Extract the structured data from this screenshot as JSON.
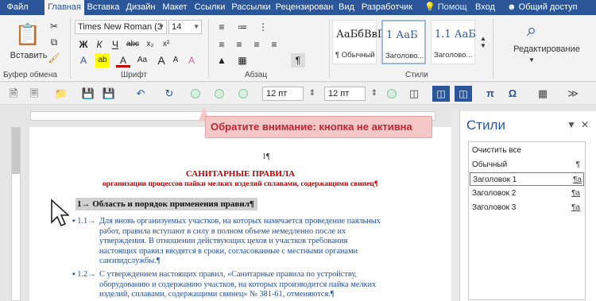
{
  "tabs": {
    "file": "Файл",
    "home": "Главная",
    "insert": "Вставка",
    "design": "Дизайн",
    "layout": "Макет",
    "references": "Ссылки",
    "mailings": "Рассылки",
    "review": "Рецензирован",
    "view": "Вид",
    "developer": "Разработчик",
    "help": "Помощ",
    "signin": "Вход",
    "share": "Общий доступ"
  },
  "ribbon": {
    "clipboard": {
      "label": "Буфер обмена",
      "paste": "Вставить"
    },
    "font": {
      "label": "Шрифт",
      "name": "Times New Roman (З",
      "size": "14",
      "bold": "Ж",
      "italic": "К",
      "underline": "Ч",
      "strike": "abc",
      "sub": "x₂",
      "sup": "x²",
      "grow": "A",
      "shrink": "A",
      "case": "Aa",
      "clear": "A",
      "effects": "A",
      "highlight": "ab",
      "color": "A"
    },
    "paragraph": {
      "label": "Абзац",
      "marks": "¶"
    },
    "styles": {
      "label": "Стили",
      "items": [
        {
          "sample": "АаБбВвГ",
          "name": "¶ Обычный"
        },
        {
          "sample": "1 АаБ",
          "name": "Заголово..."
        },
        {
          "sample": "1.1 АаБ",
          "name": "Заголово..."
        }
      ]
    },
    "editing": {
      "label": "Редактирование"
    }
  },
  "quickbar": {
    "size1": "12 пт",
    "size2": "12 пт",
    "pi": "π",
    "omega": "Ω"
  },
  "tooltip": "Обратите внимание: кнопка не активна",
  "document": {
    "page_number": "1¶",
    "title": "САНИТАРНЫЕ ПРАВИЛА",
    "subtitle": "организации процессов пайки мелких изделий сплавами, содержащими свинец¶",
    "heading": "1→ Область и порядок применения правил¶",
    "paragraphs": [
      {
        "num": "▪ 1.1→",
        "lines": [
          "Для вновь организуемых участков, на которых намечается проведение паяльных",
          "работ, правила вступают в силу в полном объеме немедленно после их",
          "утверждения. В отношении действующих цехов и участков требования",
          "настоящих правил вводятся в сроки, согласованные с местными органами",
          "санэпидслужбы.¶"
        ]
      },
      {
        "num": "▪ 1.2→",
        "lines": [
          "С утверждением настоящих правил, «Санитарные правила по устройству,",
          "оборудованию и содержанию участков, на которых производится пайка мелких",
          "изделий, сплавами, содержащими свинец» № 381-61, отменяются.¶"
        ]
      }
    ]
  },
  "styles_pane": {
    "title": "Стили",
    "items": [
      {
        "name": "Очистить все",
        "mark": ""
      },
      {
        "name": "Обычный",
        "mark": "¶"
      },
      {
        "name": "Заголовок 1",
        "mark": "¶a"
      },
      {
        "name": "Заголовок 2",
        "mark": "¶a"
      },
      {
        "name": "Заголовок 3",
        "mark": "¶a"
      }
    ]
  },
  "colors": {
    "ribbon_blue": "#2b579a",
    "doc_red": "#c00000",
    "doc_blue": "#1f4e9a",
    "tooltip_bg": "#f6c7c7",
    "tooltip_text": "#c0262f"
  }
}
